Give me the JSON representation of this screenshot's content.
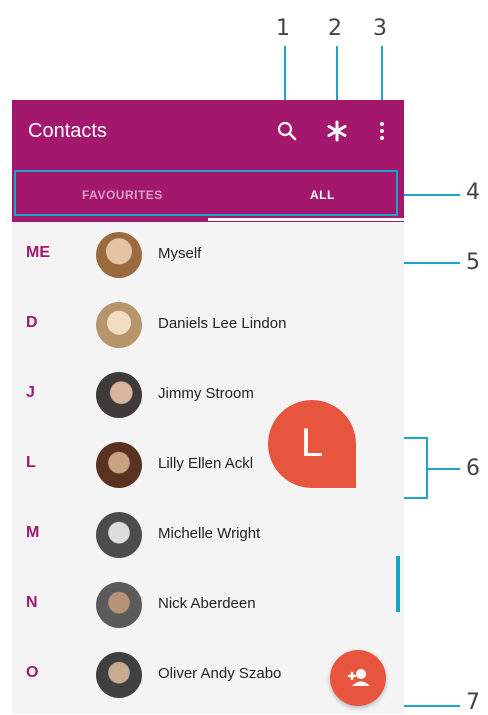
{
  "app": {
    "title": "Contacts",
    "accent_color": "#a3176d",
    "fab_color": "#e8553f"
  },
  "toolbar": {
    "icons": [
      "search-icon",
      "asterisk-icon",
      "more-vert-icon"
    ]
  },
  "tabs": [
    {
      "label": "FAVOURITES",
      "selected": false
    },
    {
      "label": "ALL",
      "selected": true
    }
  ],
  "contacts": [
    {
      "section": "ME",
      "name": "Myself"
    },
    {
      "section": "D",
      "name": "Daniels Lee Lindon"
    },
    {
      "section": "J",
      "name": "Jimmy Stroom"
    },
    {
      "section": "L",
      "name": "Lilly Ellen Ackl"
    },
    {
      "section": "M",
      "name": "Michelle Wright"
    },
    {
      "section": "N",
      "name": "Nick Aberdeen"
    },
    {
      "section": "O",
      "name": "Oliver Andy Szabo"
    }
  ],
  "scroll_letter": "L",
  "callouts": [
    "1",
    "2",
    "3",
    "4",
    "5",
    "6",
    "7"
  ],
  "fab_icon": "add-contact-icon"
}
